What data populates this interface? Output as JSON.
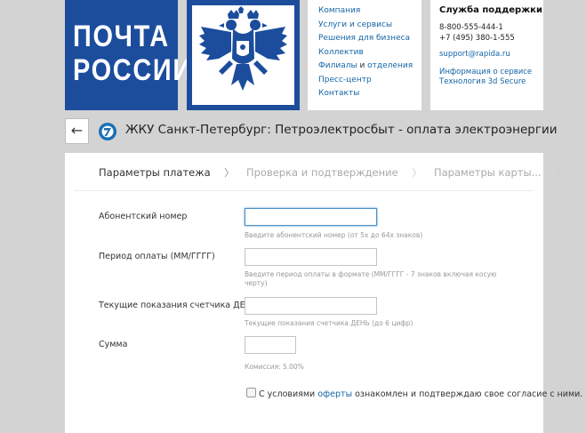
{
  "logo": {
    "line1": "ПОЧТА",
    "line2": "РОССИИ",
    "emblem_icon": "double-headed-eagle-icon",
    "brand_color": "#1c4d9d"
  },
  "nav": {
    "links": [
      {
        "label": "Компания"
      },
      {
        "label": "Услуги и сервисы"
      },
      {
        "label": "Решения для бизнеса"
      },
      {
        "label": "Коллектив"
      },
      {
        "label_a": "Филиалы",
        "label_b": " и ",
        "label_c": "отделения"
      },
      {
        "label": "Пресс-центр"
      },
      {
        "label": "Контакты"
      }
    ]
  },
  "support": {
    "title": "Служба поддержки",
    "phone1": "8-800-555-444-1",
    "phone2": "+7 (495) 380-1-555",
    "email": "support@rapida.ru",
    "info1": "Информация о сервисе",
    "info2": "Технология 3d Secure"
  },
  "header": {
    "back_icon": "arrow-left-icon",
    "service_icon": "rapida-icon",
    "title": "ЖКУ Санкт-Петербург: Петроэлектросбыт - оплата электроэнергии"
  },
  "steps": [
    {
      "label": "Параметры платежа",
      "state": "active"
    },
    {
      "label": "Проверка и подтверждение",
      "state": "inactive"
    },
    {
      "label": "Параметры карты...",
      "state": "inactive"
    }
  ],
  "step_separator": "〉",
  "form": {
    "account": {
      "label": "Абонентский номер",
      "value": "",
      "hint": "Введите абонентский номер (от 5х до 64х знаков)"
    },
    "period": {
      "label": "Период оплаты (ММ/ГГГГ)",
      "value": "",
      "hint_1": "Введите период оплаты в формате (ММ/ГГГГ - 7 знаков включая косую",
      "hint_2": "черту)"
    },
    "meter": {
      "label": "Текущие показания счетчика ДЕНЬ",
      "value": "",
      "hint": "Текущие показания счетчика ДЕНЬ (до 6 цифр)"
    },
    "amount": {
      "label": "Сумма",
      "value": "",
      "hint": "Комиссия: 5.00%"
    },
    "agree": {
      "checked": false,
      "text_before": "С условиями ",
      "link": "оферты",
      "text_after": " ознакомлен и подтверждаю свое согласие с ними."
    }
  }
}
